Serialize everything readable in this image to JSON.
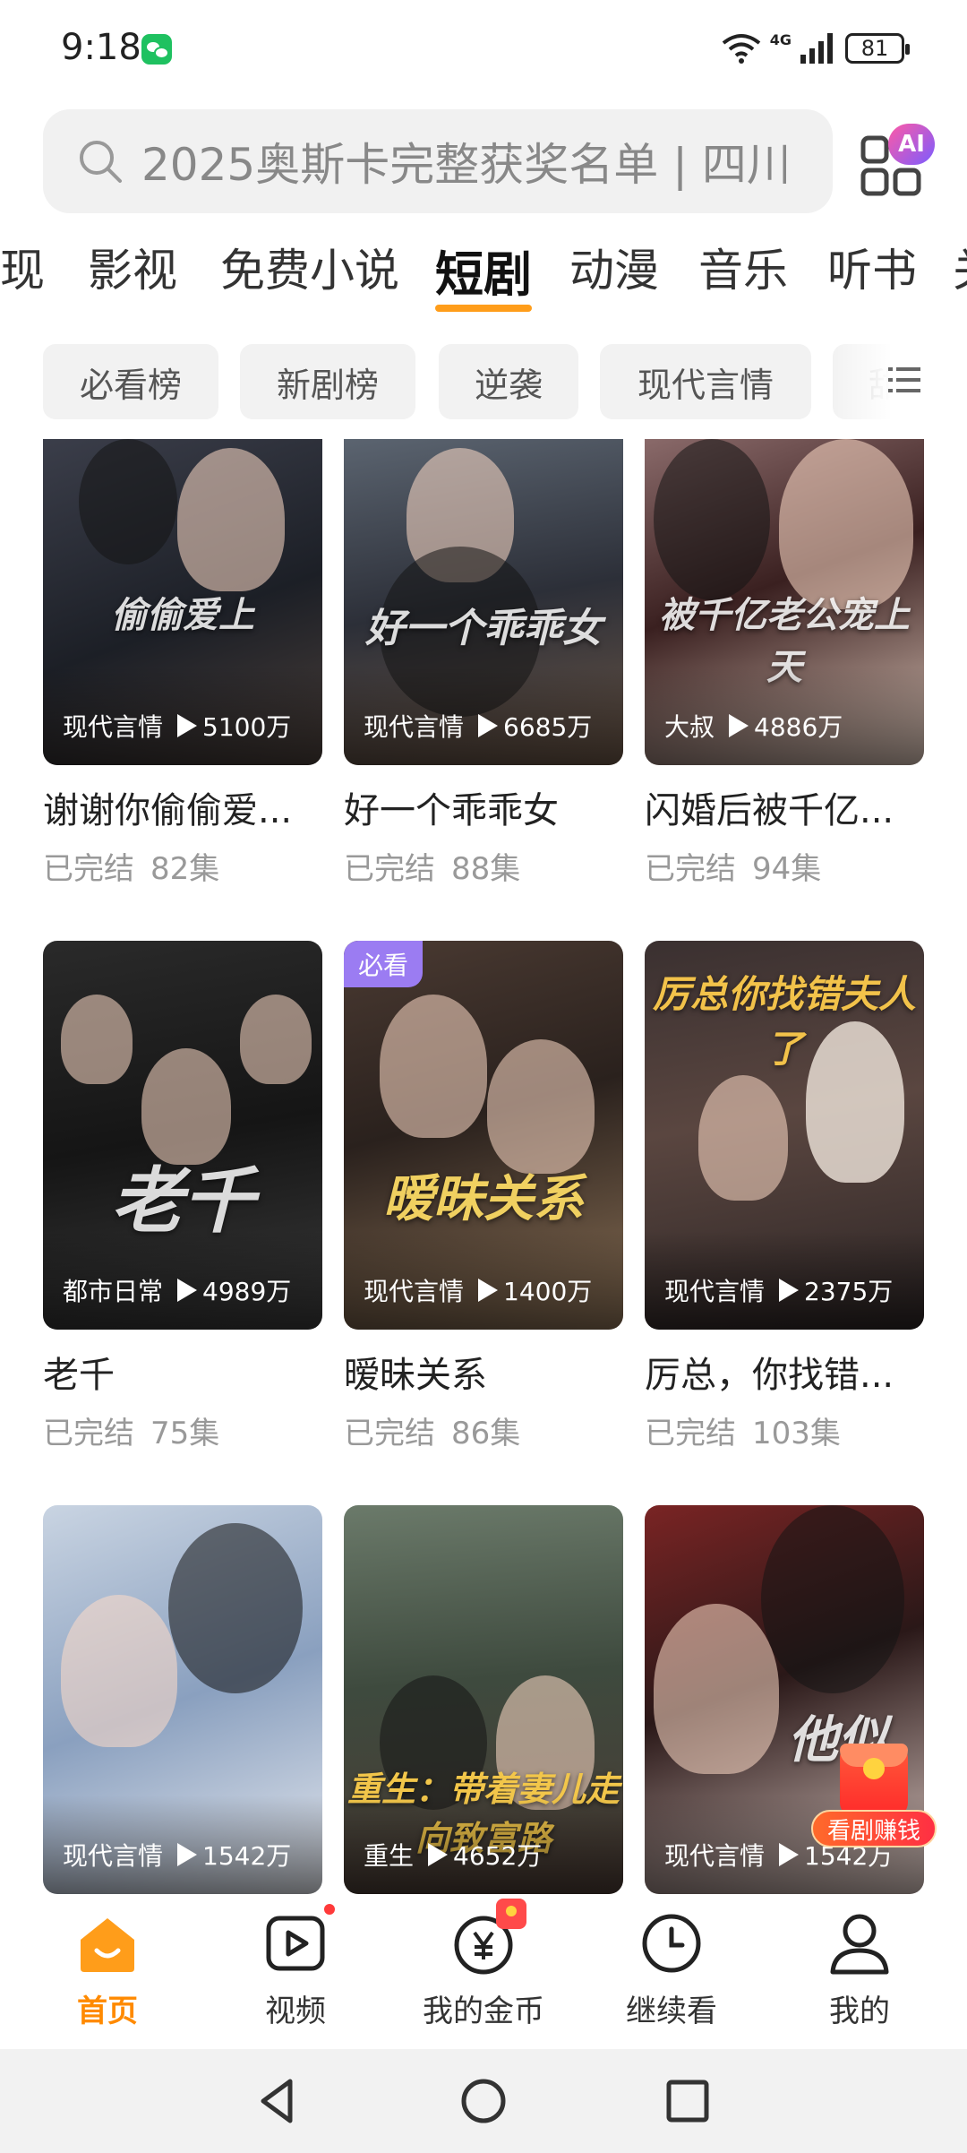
{
  "status": {
    "time": "9:18",
    "network": "4G",
    "battery": "81"
  },
  "search": {
    "placeholder": "2025奥斯卡完整获奖名单 | 四川",
    "ai_badge": "AI"
  },
  "category_tabs": [
    {
      "label": "现"
    },
    {
      "label": "影视"
    },
    {
      "label": "免费小说"
    },
    {
      "label": "短剧",
      "active": true
    },
    {
      "label": "动漫"
    },
    {
      "label": "音乐"
    },
    {
      "label": "听书"
    },
    {
      "label": "关"
    }
  ],
  "filter_chips": [
    {
      "label": "必看榜"
    },
    {
      "label": "新剧榜"
    },
    {
      "label": "逆袭"
    },
    {
      "label": "现代言情"
    },
    {
      "label": "甜"
    }
  ],
  "dramas": [
    {
      "genre": "现代言情",
      "views": "5100万",
      "title": "谢谢你偷偷爱...",
      "status": "已完结",
      "episodes": "82集"
    },
    {
      "genre": "现代言情",
      "views": "6685万",
      "title": "好一个乖乖女",
      "status": "已完结",
      "episodes": "88集"
    },
    {
      "genre": "大叔",
      "views": "4886万",
      "title": "闪婚后被千亿...",
      "status": "已完结",
      "episodes": "94集"
    },
    {
      "genre": "都市日常",
      "views": "4989万",
      "title": "老千",
      "status": "已完结",
      "episodes": "75集"
    },
    {
      "genre": "现代言情",
      "views": "1400万",
      "title": "暧昧关系",
      "status": "已完结",
      "episodes": "86集",
      "badge": "必看"
    },
    {
      "genre": "现代言情",
      "views": "2375万",
      "title": "厉总，你找错...",
      "status": "已完结",
      "episodes": "103集"
    },
    {
      "genre": "现代言情",
      "views": "1542万"
    },
    {
      "genre": "重生",
      "views": "4652万"
    },
    {
      "genre": "现代言情",
      "views": "1542万"
    }
  ],
  "poster_text": [
    "偷偷爱上",
    "好一个乖乖女",
    "被千亿老公宠上天",
    "老千",
    "暧昧关系",
    "厉总你找错夫人了",
    "",
    "重生：带着妻儿走向致富路",
    "他似"
  ],
  "earn_button": {
    "label": "看剧赚钱"
  },
  "bottom_nav": [
    {
      "label": "首页",
      "active": true
    },
    {
      "label": "视频"
    },
    {
      "label": "我的金币"
    },
    {
      "label": "继续看"
    },
    {
      "label": "我的"
    }
  ],
  "colors": {
    "accent": "#ff9d1a",
    "must_badge": "#9b7cf2",
    "chip_bg": "#f2f2f2"
  }
}
